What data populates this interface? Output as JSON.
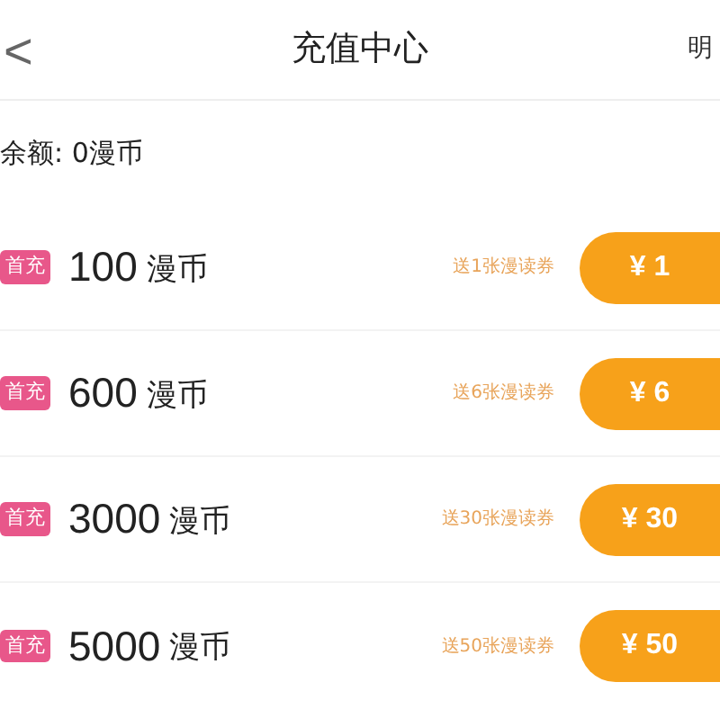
{
  "header": {
    "back": "<",
    "title": "充值中心",
    "right_link": "明"
  },
  "balance": "余额: 0漫币",
  "packages": [
    {
      "badge": "首充",
      "amount": "100",
      "unit": "漫币",
      "bonus": "送1张漫读券",
      "price": "¥ 1"
    },
    {
      "badge": "首充",
      "amount": "600",
      "unit": "漫币",
      "bonus": "送6张漫读券",
      "price": "¥ 6"
    },
    {
      "badge": "首充",
      "amount": "3000",
      "unit": "漫币",
      "bonus": "送30张漫读券",
      "price": "¥ 30"
    },
    {
      "badge": "首充",
      "amount": "5000",
      "unit": "漫币",
      "bonus": "送50张漫读券",
      "price": "¥ 50"
    }
  ]
}
